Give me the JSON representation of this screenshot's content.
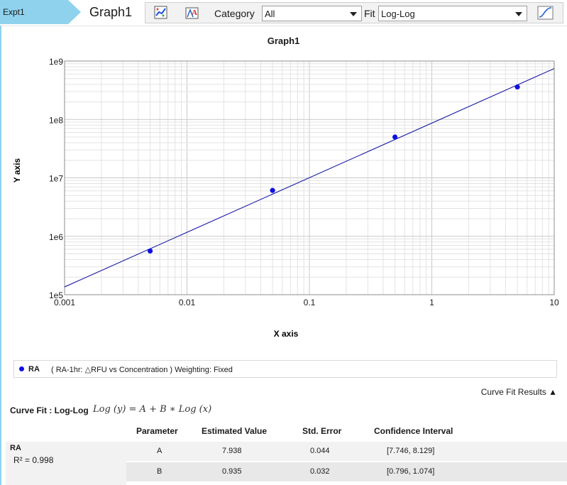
{
  "top": {
    "expt_tab": "Expt1",
    "graph_tab": "Graph1",
    "category_label": "Category",
    "category_value": "All",
    "fit_label": "Fit",
    "fit_value": "Log-Log"
  },
  "colors": {
    "tab": "#8ed2ee",
    "series": "#1010e0",
    "fit_line": "#1a1aa6"
  },
  "chart_data": {
    "type": "scatter",
    "title": "Graph1",
    "xlabel": "X axis",
    "ylabel": "Y axis",
    "xscale": "log",
    "yscale": "log",
    "xlim": [
      0.001,
      10
    ],
    "ylim": [
      100000,
      1000000000
    ],
    "xticks": [
      "0.001",
      "0.01",
      "0.1",
      "1",
      "10"
    ],
    "yticks": [
      "1e5",
      "1e6",
      "1e7",
      "1e8",
      "1e9"
    ],
    "grid": true,
    "series": [
      {
        "name": "RA",
        "x": [
          0.005,
          0.05,
          0.5,
          5
        ],
        "y": [
          560000,
          6100000,
          50000000,
          360000000
        ]
      }
    ],
    "fit": {
      "model": "Log-Log",
      "A": 7.938,
      "B": 0.935
    }
  },
  "legend": {
    "name": "RA",
    "description": "( RA-1hr: △RFU vs Concentration )  Weighting: Fixed"
  },
  "results": {
    "toggle_label": "Curve Fit Results ▲",
    "curve_fit_label": "Curve Fit : Log-Log",
    "equation": "Log (y) = A + B ∗ Log (x)",
    "headers": [
      "Parameter",
      "Estimated Value",
      "Std. Error",
      "Confidence Interval"
    ],
    "series_name": "RA",
    "r2": "R² = 0.998",
    "rows": [
      {
        "param": "A",
        "est": "7.938",
        "err": "0.044",
        "ci": "[7.746, 8.129]"
      },
      {
        "param": "B",
        "est": "0.935",
        "err": "0.032",
        "ci": "[0.796, 1.074]"
      }
    ]
  }
}
